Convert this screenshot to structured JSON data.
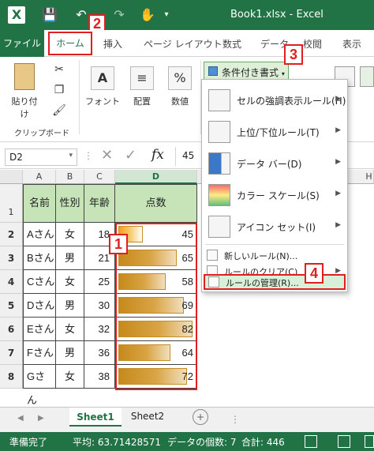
{
  "title": "Book1.xlsx - Excel",
  "tabs": [
    "ファイル",
    "ホーム",
    "挿入",
    "ページ レイアウト",
    "数式",
    "データ",
    "校閲",
    "表示"
  ],
  "ribbon": {
    "paste": "貼り付け",
    "clipboard_group": "クリップボード",
    "font": "フォント",
    "alignment": "配置",
    "number": "数値",
    "cond_format": "条件付き書式"
  },
  "formula_bar": {
    "namebox": "D2",
    "value": "45"
  },
  "columns": [
    "A",
    "B",
    "C",
    "D"
  ],
  "extra_column": "H",
  "rows": [
    "1",
    "2",
    "3",
    "4",
    "5",
    "6",
    "7",
    "8"
  ],
  "table": {
    "headers": [
      "名前",
      "性別",
      "年齢",
      "点数"
    ],
    "records": [
      {
        "name": "Aさん",
        "gender": "女",
        "age": "18",
        "score": "45",
        "ratio": 0.33
      },
      {
        "name": "Bさん",
        "gender": "男",
        "age": "21",
        "score": "65",
        "ratio": 0.79
      },
      {
        "name": "Cさん",
        "gender": "女",
        "age": "25",
        "score": "58",
        "ratio": 0.64
      },
      {
        "name": "Dさん",
        "gender": "男",
        "age": "30",
        "score": "69",
        "ratio": 0.88
      },
      {
        "name": "Eさん",
        "gender": "女",
        "age": "32",
        "score": "82",
        "ratio": 1.0
      },
      {
        "name": "Fさん",
        "gender": "男",
        "age": "36",
        "score": "64",
        "ratio": 0.7
      },
      {
        "name": "Gさん",
        "gender": "女",
        "age": "38",
        "score": "72",
        "ratio": 0.93
      }
    ]
  },
  "menu": {
    "items": [
      {
        "label": "セルの強調表示ルール(H)"
      },
      {
        "label": "上位/下位ルール(T)"
      },
      {
        "label": "データ バー(D)"
      },
      {
        "label": "カラー スケール(S)"
      },
      {
        "label": "アイコン セット(I)"
      }
    ],
    "new_rule": "新しいルール(N)...",
    "clear_rules": "ルールのクリア(C)",
    "manage_rules": "ルールの管理(R)..."
  },
  "callouts": [
    "1",
    "2",
    "3",
    "4"
  ],
  "sheets": [
    "Sheet1",
    "Sheet2"
  ],
  "status": {
    "ready": "準備完了",
    "average": "平均: 63.71428571",
    "count": "データの個数: 7",
    "sum": "合計: 446"
  },
  "colors": {
    "excel_green": "#217346",
    "header_fill": "#c6e4b8",
    "bar": "#d9a445",
    "callout": "#e02020"
  }
}
